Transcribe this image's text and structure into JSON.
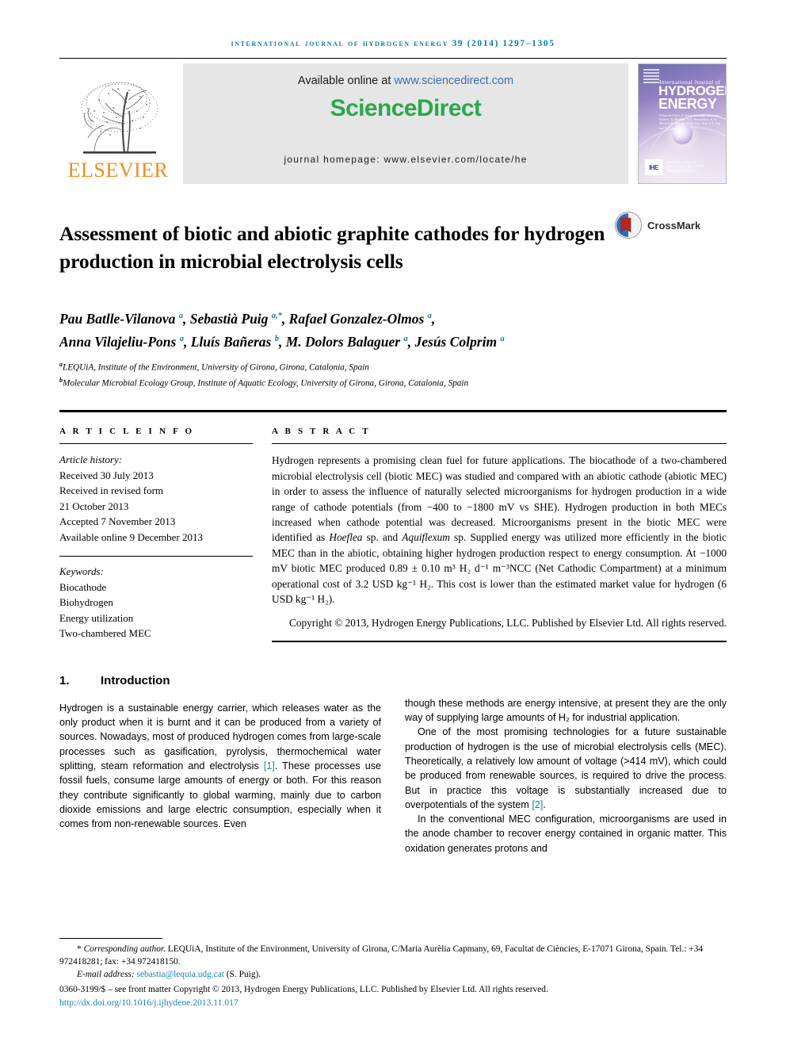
{
  "running_head": "international journal of hydrogen energy 39 (2014) 1297–1305",
  "masthead": {
    "elsevier_word": "ELSEVIER",
    "available_prefix": "Available online at ",
    "available_url": "www.sciencedirect.com",
    "sciencedirect_logo": "ScienceDirect",
    "journal_homepage": "journal homepage: www.elsevier.com/locate/he",
    "cover": {
      "line1": "International Journal of",
      "line2": "HYDROGEN",
      "line3": "ENERGY",
      "editors": "Editor-in-Chief:  T. Nejat Veziroğlu\nAssociate Editors:  A. Hashim, D.G. Bessarabov, S. A. Sherif\nA.E. Hawabi, D.W. Tsai, Hon.\nL.L. Fan   and  D.Y. Goswami",
      "badge": "IHE",
      "sciencedirect_tag": "Available online at www.sciencedirect.com",
      "sciencedirect_label": "ScienceDirect"
    }
  },
  "article": {
    "title": "Assessment of biotic and abiotic graphite cathodes for hydrogen production in microbial electrolysis cells",
    "crossmark_label": "CrossMark",
    "authors_line1_parts": [
      {
        "name": "Pau Batlle-Vilanova ",
        "sup": "a"
      },
      {
        "name": ", Sebastià Puig ",
        "sup": "a,*"
      },
      {
        "name": ", Rafael Gonzalez-Olmos ",
        "sup": "a"
      },
      {
        "name": ",",
        "sup": ""
      }
    ],
    "authors_line2_parts": [
      {
        "name": "Anna Vilajeliu-Pons ",
        "sup": "a"
      },
      {
        "name": ", Lluís Bañeras ",
        "sup": "b"
      },
      {
        "name": ", M. Dolors Balaguer ",
        "sup": "a"
      },
      {
        "name": ", Jesús Colprim ",
        "sup": "a"
      }
    ],
    "affiliation_a_sup": "a",
    "affiliation_a": "LEQUiA, Institute of the Environment, University of Girona, Girona, Catalonia, Spain",
    "affiliation_b_sup": "b",
    "affiliation_b": "Molecular Microbial Ecology Group, Institute of Aquatic Ecology, University of Girona, Girona, Catalonia, Spain"
  },
  "article_info": {
    "label": "A R T I C L E   I N F O",
    "history_label": "Article history:",
    "received": "Received 30 July 2013",
    "revised_label": "Received in revised form",
    "revised_date": "21 October 2013",
    "accepted": "Accepted 7 November 2013",
    "available_online": "Available online 9 December 2013",
    "keywords_label": "Keywords:",
    "keywords": [
      "Biocathode",
      "Biohydrogen",
      "Energy utilization",
      "Two-chambered MEC"
    ]
  },
  "abstract": {
    "label": "A B S T R A C T",
    "text_part1": "Hydrogen represents a promising clean fuel for future applications. The biocathode of a two-chambered microbial electrolysis cell (biotic MEC) was studied and compared with an abiotic cathode (abiotic MEC) in order to assess the influence of naturally selected microorganisms for hydrogen production in a wide range of cathode potentials (from −400 to −1800 mV vs SHE). Hydrogen production in both MECs increased when cathode potential was decreased. Microorganisms present in the biotic MEC were identified as ",
    "italic1": "Hoeflea",
    "text_part2": " sp. and ",
    "italic2": "Aquiflexum",
    "text_part3": " sp. Supplied energy was utilized more efficiently in the biotic MEC than in the abiotic, obtaining higher hydrogen production respect to energy consumption. At −1000 mV biotic MEC produced 0.89 ± 0.10 m³ H₂ d⁻¹ m⁻³NCC (Net Cathodic Compartment) at a minimum operational cost of 3.2 USD kg⁻¹ H₂. This cost is lower than the estimated market value for hydrogen (6 USD kg⁻¹ H₂).",
    "copyright": "Copyright © 2013, Hydrogen Energy Publications, LLC. Published by Elsevier Ltd. All rights reserved."
  },
  "introduction": {
    "number": "1.",
    "heading": "Introduction",
    "left_para1_a": "Hydrogen is a sustainable energy carrier, which releases water as the only product when it is burnt and it can be produced from a variety of sources. Nowadays, most of produced hydrogen comes from large-scale processes such as gasification, pyrolysis, thermochemical water splitting, steam reformation and electrolysis ",
    "left_cite1": "[1]",
    "left_para1_b": ". These processes use fossil fuels, consume large amounts of energy or both. For this reason they contribute significantly to global warming, mainly due to carbon dioxide emissions and large electric consumption, especially when it comes from non-renewable sources. Even",
    "right_para1": "though these methods are energy intensive, at present they are the only way of supplying large amounts of H₂ for industrial application.",
    "right_para2": "One of the most promising technologies for a future sustainable production of hydrogen is the use of microbial electrolysis cells (MEC). Theoretically, a relatively low amount of voltage (>414 mV), which could be produced from renewable sources, is required to drive the process. But in practice this voltage is substantially increased due to overpotentials of the system ",
    "right_cite2": "[2]",
    "right_para2_end": ".",
    "right_para3": "In the conventional MEC configuration, microorganisms are used in the anode chamber to recover energy contained in organic matter. This oxidation generates protons and"
  },
  "footnote": {
    "star": "*",
    "corresponding_label": "Corresponding author.",
    "corresponding_address": " LEQUiA, Institute of the Environment, University of Girona, C/Maria Aurèlia Capmany, 69, Facultat de Ciències, E-17071 Girona, Spain. Tel.: +34 972418281; fax: +34 972418150.",
    "email_label": "E-mail address: ",
    "email": "sebastia@lequia.udg.cat",
    "email_suffix": " (S. Puig).",
    "front_matter": "0360-3199/$ – see front matter Copyright © 2013, Hydrogen Energy Publications, LLC. Published by Elsevier Ltd. All rights reserved.",
    "doi": "http://dx.doi.org/10.1016/j.ijhydene.2013.11.017"
  },
  "colors": {
    "accent_blue": "#0b7ba8",
    "link_blue": "#1b7fb5",
    "elsevier_orange": "#f08c1e",
    "sciencedirect_green": "#2aa84a"
  }
}
